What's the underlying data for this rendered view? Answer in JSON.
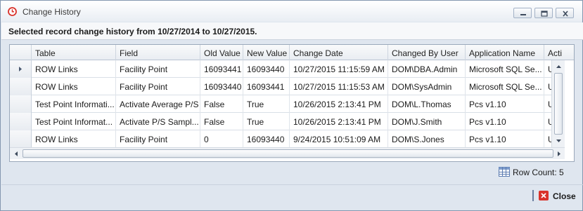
{
  "window": {
    "title": "Change History",
    "minimize_icon": "minimize-icon",
    "restore_icon": "restore-icon",
    "close_icon": "close-icon"
  },
  "subheader": {
    "text": "Selected record change history from 10/27/2014 to 10/27/2015."
  },
  "grid": {
    "columns": [
      "Table",
      "Field",
      "Old Value",
      "New Value",
      "Change Date",
      "Changed By User",
      "Application Name",
      "Acti"
    ],
    "rows": [
      [
        "ROW Links",
        "Facility Point",
        "16093441",
        "16093440",
        "10/27/2015 11:15:59 AM",
        "DOM\\DBA.Admin",
        "Microsoft SQL Se...",
        "Upc"
      ],
      [
        "ROW Links",
        "Facility Point",
        "16093440",
        "16093441",
        "10/27/2015 11:15:53 AM",
        "DOM\\SysAdmin",
        "Microsoft SQL Se...",
        "Upc"
      ],
      [
        "Test Point Informati...",
        "Activate Average P/S",
        "False",
        "True",
        "10/26/2015 2:13:41 PM",
        "DOM\\L.Thomas",
        "Pcs v1.10",
        "Upc"
      ],
      [
        "Test Point Informat...",
        "Activate P/S Sampl...",
        "False",
        "True",
        "10/26/2015 2:13:41 PM",
        "DOM\\J.Smith",
        "Pcs v1.10",
        "Upc"
      ],
      [
        "ROW Links",
        "Facility Point",
        "0",
        "16093440",
        "9/24/2015 10:51:09 AM",
        "DOM\\S.Jones",
        "Pcs v1.10",
        "Upc"
      ]
    ],
    "current_row_indicator": "row-pointer-icon"
  },
  "status": {
    "row_count_label": "Row Count:",
    "row_count_value": "5",
    "row_count_display": "Row Count:  5"
  },
  "footer": {
    "close_label": "Close"
  },
  "colors": {
    "accent_red": "#d9322a",
    "window_bg": "#dfe6ef",
    "border": "#8497b0"
  }
}
